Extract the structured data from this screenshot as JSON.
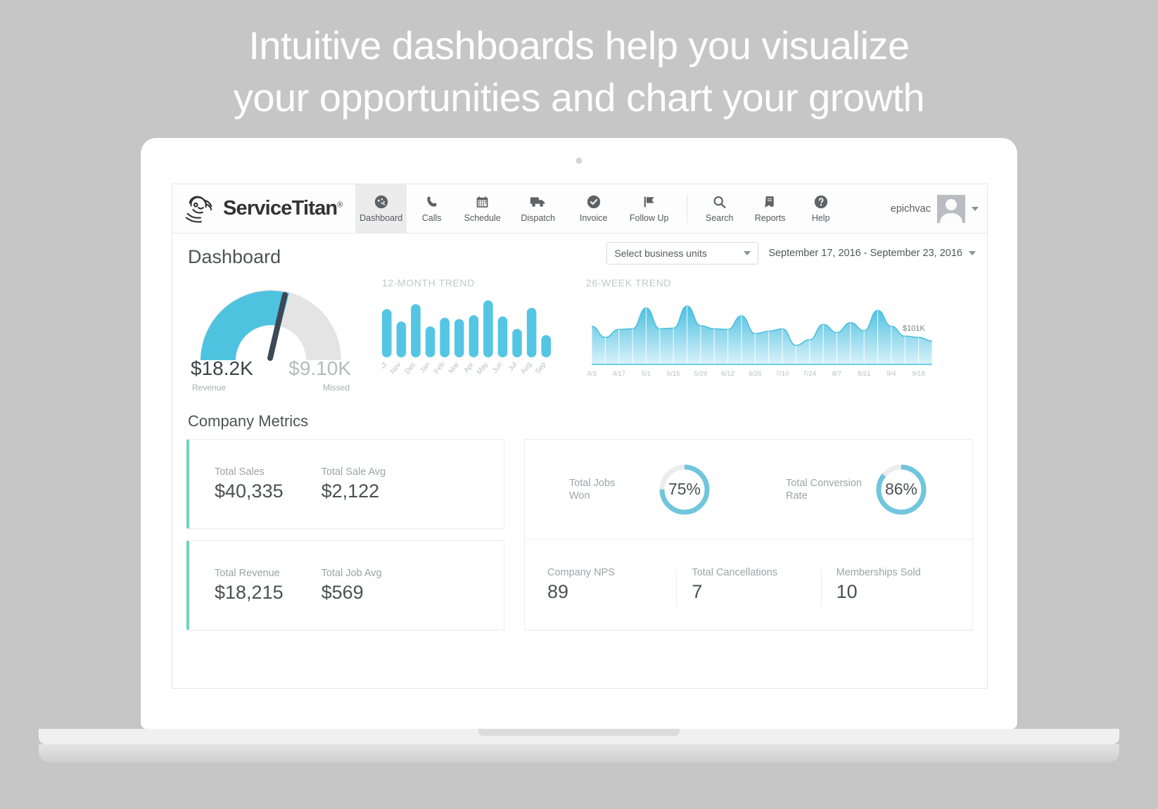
{
  "headline": {
    "line1": "Intuitive dashboards help you visualize",
    "line2": "your opportunities and chart your growth"
  },
  "colors": {
    "accent_blue": "#55c5e4",
    "accent_green": "#6fd3bd",
    "gauge_gray": "#e2e2e2",
    "needle": "#3c4a56",
    "text_dark": "#4c5053",
    "text_muted": "#9fa3a6"
  },
  "topnav": {
    "brand": "ServiceTitan",
    "brand_tm": "®",
    "items": [
      {
        "label": "Dashboard",
        "icon": "gauge-icon",
        "active": true
      },
      {
        "label": "Calls",
        "icon": "phone-icon",
        "active": false
      },
      {
        "label": "Schedule",
        "icon": "calendar-icon",
        "active": false
      },
      {
        "label": "Dispatch",
        "icon": "truck-icon",
        "active": false
      },
      {
        "label": "Invoice",
        "icon": "check-circle-icon",
        "active": false
      },
      {
        "label": "Follow Up",
        "icon": "flag-icon",
        "active": false
      }
    ],
    "utility_items": [
      {
        "label": "Search",
        "icon": "search-icon"
      },
      {
        "label": "Reports",
        "icon": "book-icon"
      },
      {
        "label": "Help",
        "icon": "question-circle-icon"
      }
    ],
    "user": {
      "name": "epichvac",
      "avatar": "user-avatar"
    }
  },
  "page": {
    "title": "Dashboard",
    "business_units_label": "Select business units",
    "date_range": "September 17, 2016 -  September 23, 2016"
  },
  "gauge": {
    "revenue_value": "$18.2K",
    "revenue_label": "Revenue",
    "missed_value": "$9.10K",
    "missed_label": "Missed",
    "percent_filled": 66
  },
  "chart_data": [
    {
      "type": "bar",
      "title": "12-MONTH TREND",
      "categories": [
        "Oct",
        "Nov",
        "Dec",
        "Jan",
        "Feb",
        "Mar",
        "Apr",
        "May",
        "Jun",
        "Jul",
        "Aug",
        "Sep"
      ],
      "values": [
        78,
        58,
        86,
        50,
        64,
        62,
        68,
        92,
        66,
        46,
        80,
        36
      ],
      "xlabel": "",
      "ylabel": "",
      "ylim": [
        0,
        100
      ],
      "grid": false,
      "legend": false,
      "color": "#55c5e4"
    },
    {
      "type": "area",
      "title": "26-WEEK TREND",
      "x": [
        "4/3",
        "4/10",
        "4/17",
        "4/24",
        "5/1",
        "5/8",
        "5/15",
        "5/22",
        "5/29",
        "6/5",
        "6/12",
        "6/19",
        "6/26",
        "7/3",
        "7/10",
        "7/17",
        "7/24",
        "7/31",
        "8/7",
        "8/14",
        "8/21",
        "8/28",
        "9/4",
        "9/11",
        "9/18",
        "9/25"
      ],
      "tick_labels": [
        "4/3",
        "4/17",
        "5/1",
        "5/15",
        "5/29",
        "6/12",
        "6/26",
        "7/10",
        "7/24",
        "8/7",
        "8/21",
        "9/4",
        "9/18"
      ],
      "values": [
        62,
        44,
        57,
        58,
        92,
        58,
        59,
        95,
        63,
        58,
        57,
        79,
        50,
        54,
        58,
        31,
        40,
        65,
        52,
        68,
        55,
        88,
        62,
        46,
        44,
        38
      ],
      "annotation": {
        "label": "$101K",
        "at_x": "9/18"
      },
      "xlabel": "",
      "ylabel": "",
      "ylim": [
        0,
        100
      ],
      "grid": true,
      "legend": false,
      "color": "#55c5e4"
    }
  ],
  "company_metrics": {
    "section_title": "Company Metrics",
    "cards": [
      {
        "cells": [
          {
            "label": "Total Sales",
            "value": "$40,335"
          },
          {
            "label": "Total Sale Avg",
            "value": "$2,122"
          }
        ]
      },
      {
        "cells": [
          {
            "label": "Total Revenue",
            "value": "$18,215"
          },
          {
            "label": "Total Job Avg",
            "value": "$569"
          }
        ]
      }
    ],
    "donuts": [
      {
        "label_line1": "Total Jobs",
        "label_line2": "Won",
        "value": "75%",
        "percent": 75
      },
      {
        "label_line1": "Total Conversion",
        "label_line2": "Rate",
        "value": "86%",
        "percent": 86
      }
    ],
    "stats": [
      {
        "label": "Company NPS",
        "value": "89"
      },
      {
        "label": "Total Cancellations",
        "value": "7"
      },
      {
        "label": "Memberships Sold",
        "value": "10"
      }
    ]
  }
}
